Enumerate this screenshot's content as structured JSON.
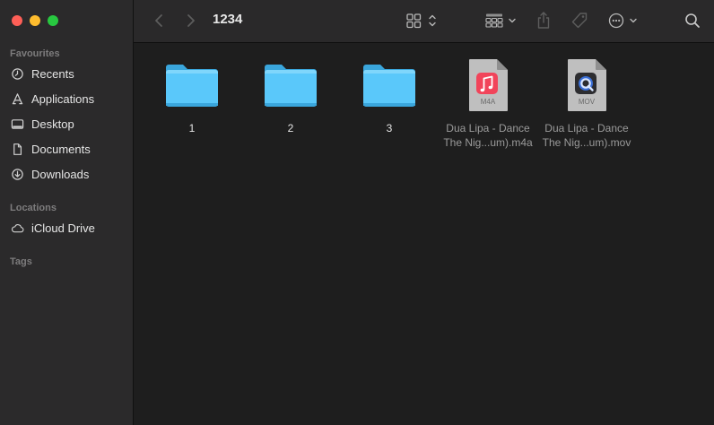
{
  "window": {
    "title": "1234"
  },
  "sidebar": {
    "sections": [
      {
        "title": "Favourites",
        "items": [
          {
            "label": "Recents",
            "icon": "clock-icon"
          },
          {
            "label": "Applications",
            "icon": "applications-icon"
          },
          {
            "label": "Desktop",
            "icon": "desktop-icon"
          },
          {
            "label": "Documents",
            "icon": "document-icon"
          },
          {
            "label": "Downloads",
            "icon": "download-icon"
          }
        ]
      },
      {
        "title": "Locations",
        "items": [
          {
            "label": "iCloud Drive",
            "icon": "cloud-icon"
          }
        ]
      },
      {
        "title": "Tags",
        "items": []
      }
    ]
  },
  "toolbar": {
    "back": "back-chevron-icon",
    "forward": "forward-chevron-icon",
    "view_mode": "grid-view-icon",
    "group": "group-by-icon",
    "share": "share-icon",
    "tag": "tag-icon",
    "more": "more-actions-icon",
    "search": "search-icon"
  },
  "files": [
    {
      "name": "1",
      "kind": "folder"
    },
    {
      "name": "2",
      "kind": "folder"
    },
    {
      "name": "3",
      "kind": "folder"
    },
    {
      "name": "Dua Lipa - Dance The Nig...um).m4a",
      "line1": "Dua Lipa - Dance",
      "line2": "The Nig...um).m4a",
      "kind": "m4a",
      "badge": "M4A"
    },
    {
      "name": "Dua Lipa - Dance The Nig...um).mov",
      "line1": "Dua Lipa - Dance",
      "line2": "The Nig...um).mov",
      "kind": "mov",
      "badge": "MOV"
    }
  ],
  "colors": {
    "sidebar_bg": "#2b2a2b",
    "content_bg": "#1e1e1e",
    "folder_blue": "#5ac8fa",
    "music_red": "#f1445a"
  }
}
